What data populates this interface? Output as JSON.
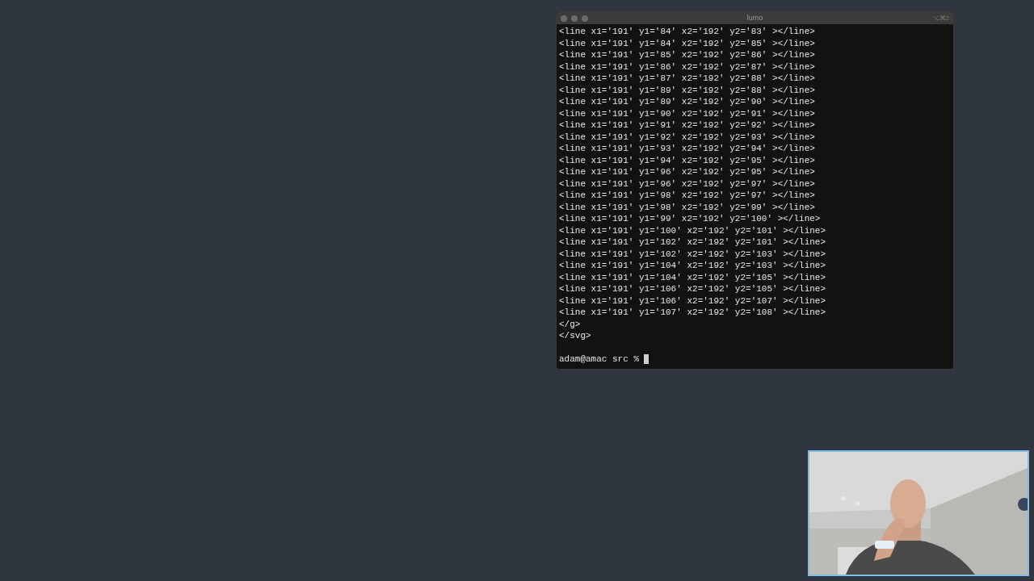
{
  "window": {
    "title": "lumo",
    "shortcut": "⌥⌘2"
  },
  "terminal": {
    "output": [
      "<line x1='191' y1='84' x2='192' y2='83' ></line>",
      "<line x1='191' y1='84' x2='192' y2='85' ></line>",
      "<line x1='191' y1='85' x2='192' y2='86' ></line>",
      "<line x1='191' y1='86' x2='192' y2='87' ></line>",
      "<line x1='191' y1='87' x2='192' y2='88' ></line>",
      "<line x1='191' y1='89' x2='192' y2='88' ></line>",
      "<line x1='191' y1='89' x2='192' y2='90' ></line>",
      "<line x1='191' y1='90' x2='192' y2='91' ></line>",
      "<line x1='191' y1='91' x2='192' y2='92' ></line>",
      "<line x1='191' y1='92' x2='192' y2='93' ></line>",
      "<line x1='191' y1='93' x2='192' y2='94' ></line>",
      "<line x1='191' y1='94' x2='192' y2='95' ></line>",
      "<line x1='191' y1='96' x2='192' y2='95' ></line>",
      "<line x1='191' y1='96' x2='192' y2='97' ></line>",
      "<line x1='191' y1='98' x2='192' y2='97' ></line>",
      "<line x1='191' y1='98' x2='192' y2='99' ></line>",
      "<line x1='191' y1='99' x2='192' y2='100' ></line>",
      "<line x1='191' y1='100' x2='192' y2='101' ></line>",
      "<line x1='191' y1='102' x2='192' y2='101' ></line>",
      "<line x1='191' y1='102' x2='192' y2='103' ></line>",
      "<line x1='191' y1='104' x2='192' y2='103' ></line>",
      "<line x1='191' y1='104' x2='192' y2='105' ></line>",
      "<line x1='191' y1='106' x2='192' y2='105' ></line>",
      "<line x1='191' y1='106' x2='192' y2='107' ></line>",
      "<line x1='191' y1='107' x2='192' y2='108' ></line>",
      "</g>",
      "</svg>"
    ],
    "prompt": "adam@amac src %"
  }
}
